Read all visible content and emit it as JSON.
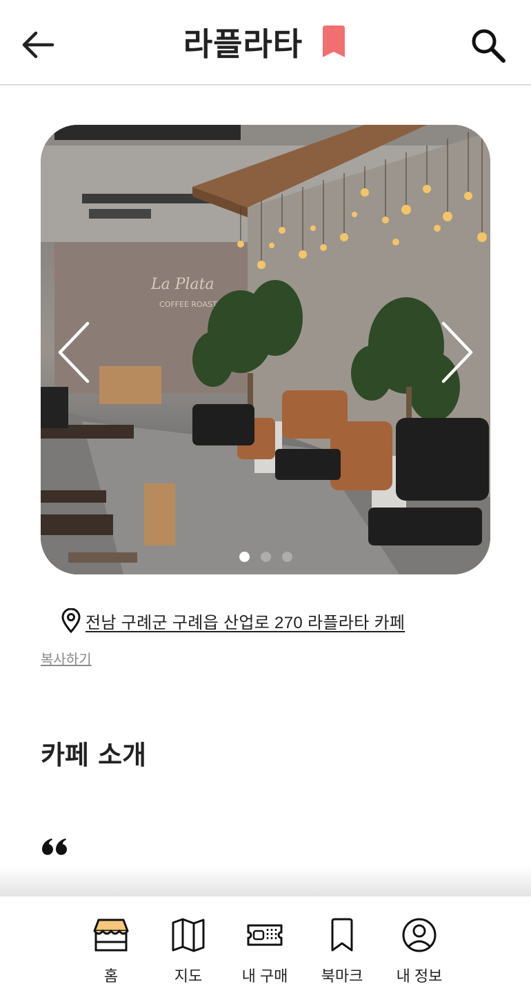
{
  "header": {
    "title": "라플라타",
    "accent_color": "#f26f6f",
    "icons": [
      "back-arrow-icon",
      "bookmark-icon",
      "search-icon"
    ]
  },
  "carousel": {
    "image_description_icon": "cafe-interior-photo",
    "slide_count": 3,
    "active_index": 0
  },
  "location": {
    "address": "전남 구례군 구례읍 산업로 270 라플라타 카페",
    "copy_label": "복사하기"
  },
  "intro": {
    "title": "카페 소개"
  },
  "bottom_nav": {
    "items": [
      {
        "label": "홈",
        "icon": "store-icon"
      },
      {
        "label": "지도",
        "icon": "map-icon"
      },
      {
        "label": "내 구매",
        "icon": "ticket-icon"
      },
      {
        "label": "북마크",
        "icon": "bookmark-outline-icon"
      },
      {
        "label": "내 정보",
        "icon": "user-circle-icon"
      }
    ],
    "home_icon_color": "#f7c77e"
  }
}
